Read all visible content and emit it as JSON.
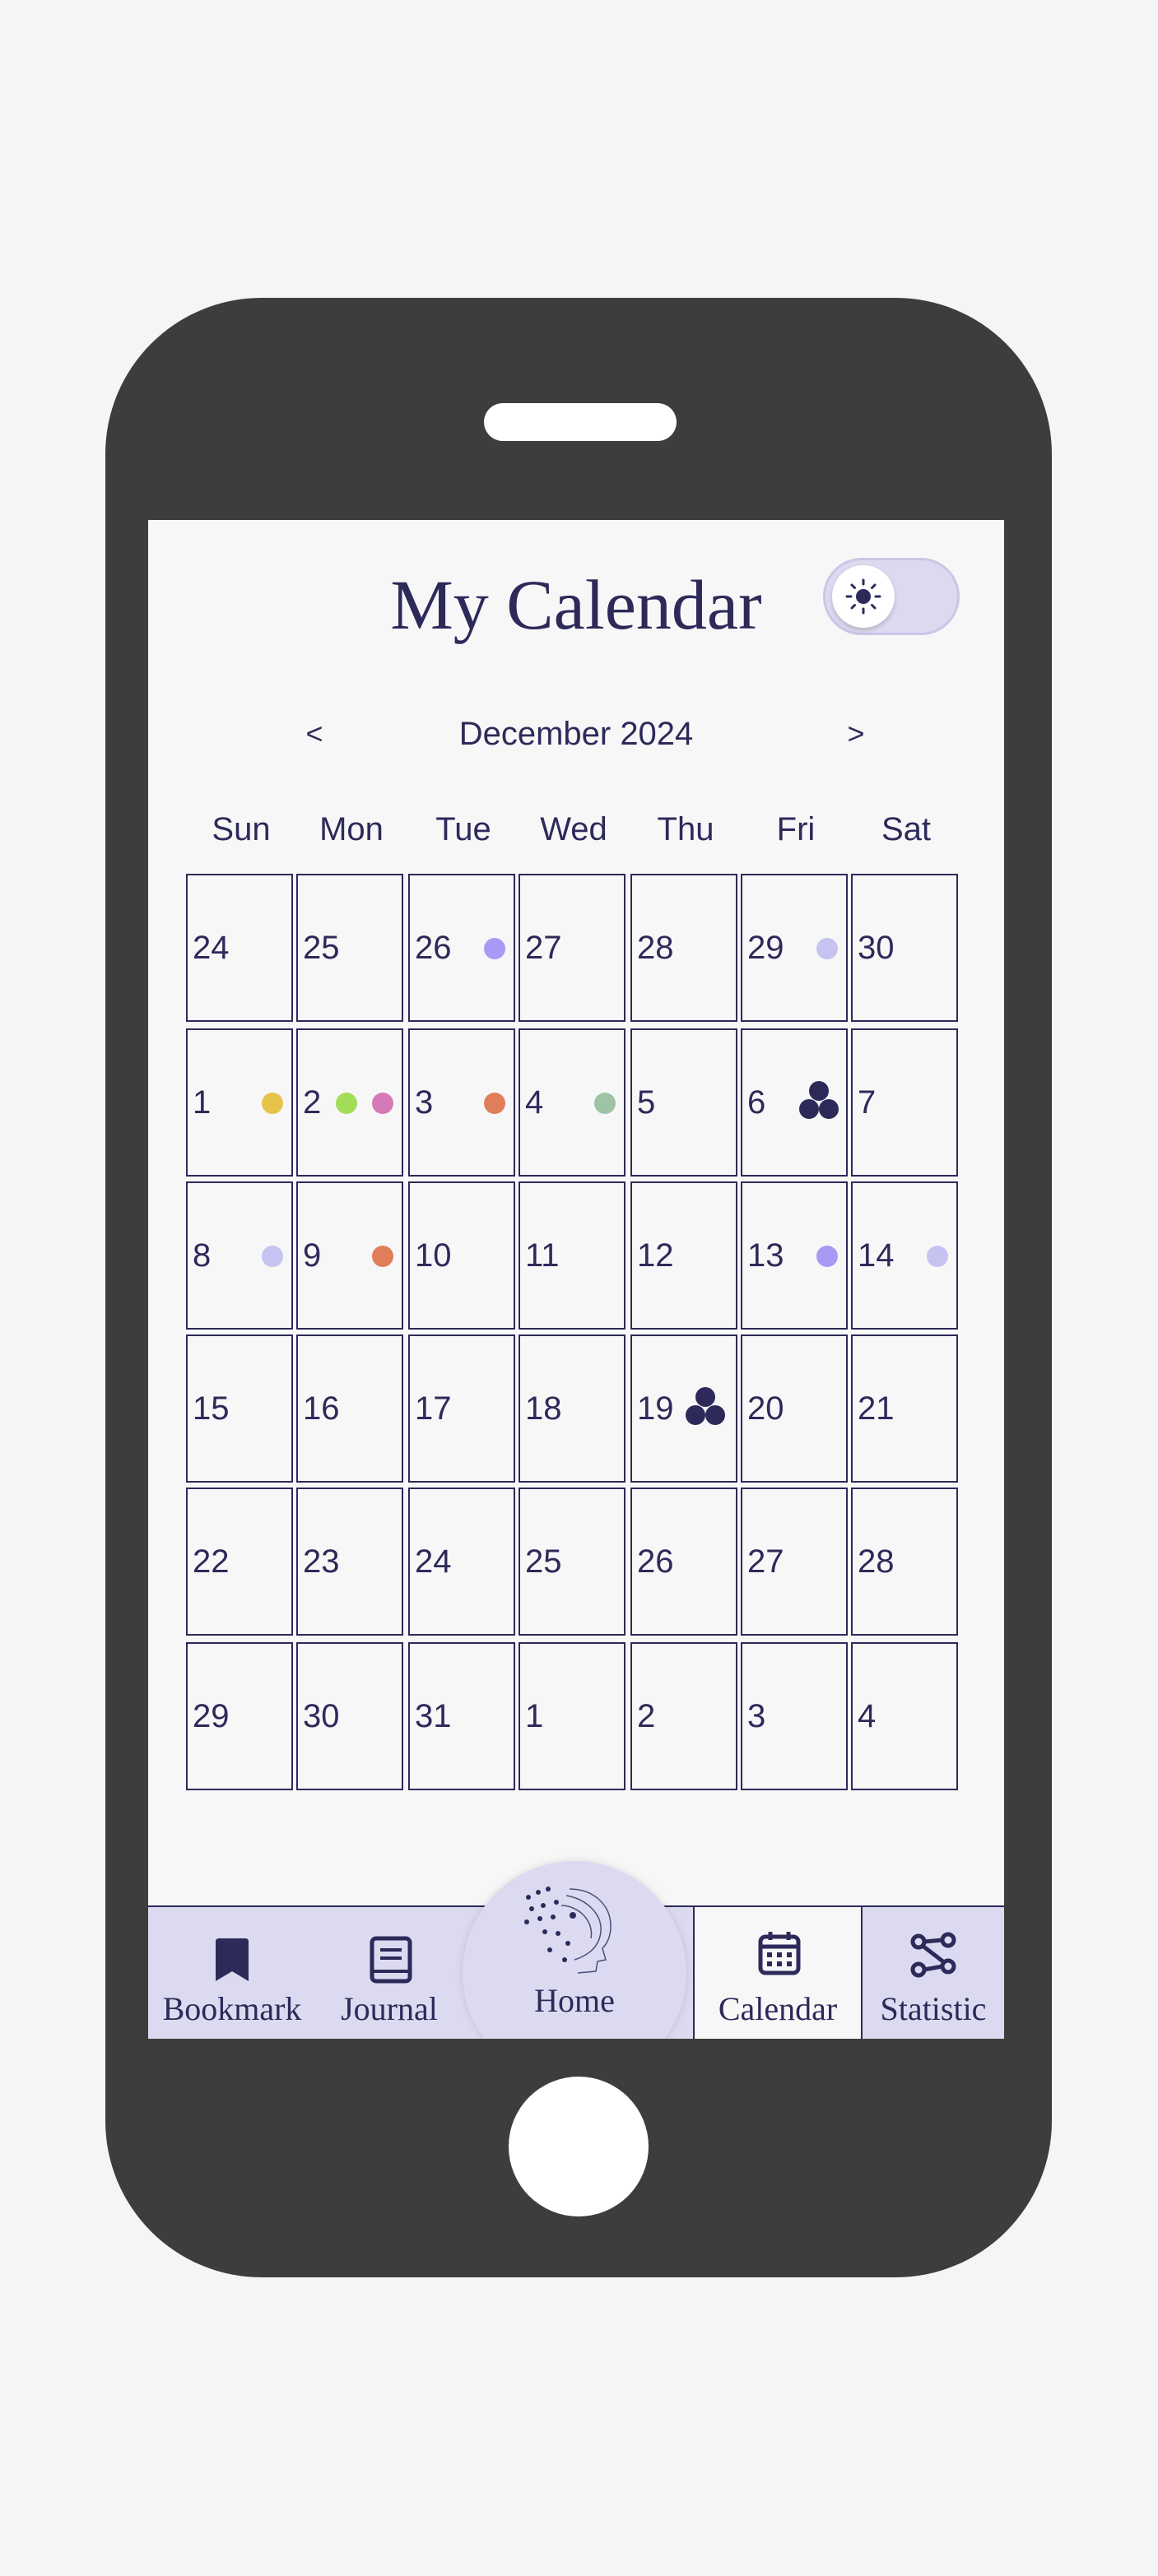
{
  "header": {
    "title": "My Calendar",
    "theme_toggle": "light"
  },
  "nav": {
    "prev": "<",
    "month": "December 2024",
    "next": ">"
  },
  "weekdays": [
    "Sun",
    "Mon",
    "Tue",
    "Wed",
    "Thu",
    "Fri",
    "Sat"
  ],
  "weeks": [
    [
      {
        "d": "24"
      },
      {
        "d": "25"
      },
      {
        "d": "26",
        "marks": [
          "#a79af5"
        ]
      },
      {
        "d": "27"
      },
      {
        "d": "28"
      },
      {
        "d": "29",
        "marks": [
          "#c6c3f1"
        ]
      },
      {
        "d": "30"
      }
    ],
    [
      {
        "d": "1",
        "marks": [
          "#e6c34a"
        ]
      },
      {
        "d": "2",
        "marks": [
          "#a3dc56",
          "#d679b6"
        ]
      },
      {
        "d": "3",
        "marks": [
          "#e07e5c"
        ]
      },
      {
        "d": "4",
        "marks": [
          "#9fc3a6"
        ]
      },
      {
        "d": "5"
      },
      {
        "d": "6",
        "cluster": true
      },
      {
        "d": "7"
      }
    ],
    [
      {
        "d": "8",
        "marks": [
          "#c6c3f1"
        ]
      },
      {
        "d": "9",
        "marks": [
          "#e07e5c"
        ]
      },
      {
        "d": "10"
      },
      {
        "d": "11"
      },
      {
        "d": "12"
      },
      {
        "d": "13",
        "marks": [
          "#a79af5"
        ]
      },
      {
        "d": "14",
        "marks": [
          "#c6c3f1"
        ]
      }
    ],
    [
      {
        "d": "15"
      },
      {
        "d": "16"
      },
      {
        "d": "17"
      },
      {
        "d": "18"
      },
      {
        "d": "19",
        "cluster": true
      },
      {
        "d": "20"
      },
      {
        "d": "21"
      }
    ],
    [
      {
        "d": "22"
      },
      {
        "d": "23"
      },
      {
        "d": "24"
      },
      {
        "d": "25"
      },
      {
        "d": "26"
      },
      {
        "d": "27"
      },
      {
        "d": "28"
      }
    ],
    [
      {
        "d": "29"
      },
      {
        "d": "30"
      },
      {
        "d": "31"
      },
      {
        "d": "1"
      },
      {
        "d": "2"
      },
      {
        "d": "3"
      },
      {
        "d": "4"
      }
    ]
  ],
  "tabbar": {
    "bookmark": "Bookmark",
    "journal": "Journal",
    "home": "Home",
    "calendar": "Calendar",
    "statistic": "Statistic",
    "active": "calendar"
  },
  "colors": {
    "primary": "#2d2a5a",
    "accent_bg": "#dcdaf0",
    "phone": "#3d3d3b"
  }
}
